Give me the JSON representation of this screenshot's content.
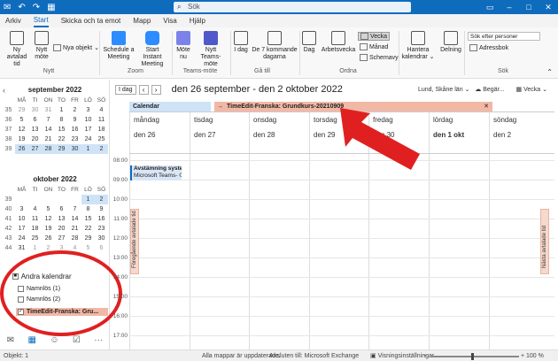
{
  "titlebar": {
    "search_placeholder": "Sök",
    "icons": [
      "envelope-icon",
      "undo-icon",
      "redo-icon",
      "calendar-icon"
    ],
    "accent": "#0f6cbd"
  },
  "menu": [
    "Arkiv",
    "Start",
    "Skicka och ta emot",
    "Mapp",
    "Visa",
    "Hjälp"
  ],
  "ribbon": {
    "new_appt": "Ny avtalad tid",
    "new_meeting": "Nytt möte",
    "new_items": "Nya objekt",
    "group_new": "Nytt",
    "schedule": "Schedule a Meeting",
    "start_instant": "Start Instant Meeting",
    "group_zoom": "Zoom",
    "meet_now": "Möte nu",
    "new_teams": "Nytt Teams-möte",
    "group_teams": "Teams-möte",
    "today": "I dag",
    "next7": "De 7 kommande dagarna",
    "group_goto": "Gå till",
    "day": "Dag",
    "workweek": "Arbetsvecka",
    "week": "Vecka",
    "month": "Månad",
    "schedule_view": "Schemavy",
    "group_arrange": "Ordna",
    "manage": "Hantera kalendrar",
    "share": "Delning",
    "search_people": "Sök efter personer",
    "addressbook": "Adressbok",
    "group_search": "Sök"
  },
  "calendar_header": {
    "today_btn": "I dag",
    "range": "den 26 september - den 2 oktober 2022",
    "tz": "Lund, Skåne län",
    "weather": "Begär...",
    "view": "Vecka"
  },
  "tabs": {
    "calendar": "Calendar",
    "timeedit": "TimeEdit-Franska: Grundkurs-20210909"
  },
  "days": [
    {
      "name": "måndag",
      "num": "den 26"
    },
    {
      "name": "tisdag",
      "num": "den 27"
    },
    {
      "name": "onsdag",
      "num": "den 28"
    },
    {
      "name": "torsdag",
      "num": "den 29"
    },
    {
      "name": "fredag",
      "num": "den 30"
    },
    {
      "name": "lördag",
      "num": "den 1 okt"
    },
    {
      "name": "söndag",
      "num": "den 2"
    }
  ],
  "times": [
    "08:00",
    "09:00",
    "10:00",
    "11:00",
    "12:00",
    "13:00",
    "14:00",
    "15:00",
    "16:00",
    "17:00"
  ],
  "event": {
    "title": "Avstämning system",
    "sub": "Microsoft Teams-"
  },
  "side_tabs": {
    "prev": "Föregående avtalade tid",
    "next": "Nästa avtalade tid"
  },
  "mini_sep": {
    "title": "september 2022",
    "headers": [
      "MÅ",
      "TI",
      "ON",
      "TO",
      "FR",
      "LÖ",
      "SÖ"
    ],
    "weeks": [
      [
        "35",
        "29",
        "30",
        "31",
        "1",
        "2",
        "3",
        "4"
      ],
      [
        "36",
        "5",
        "6",
        "7",
        "8",
        "9",
        "10",
        "11"
      ],
      [
        "37",
        "12",
        "13",
        "14",
        "15",
        "16",
        "17",
        "18"
      ],
      [
        "38",
        "19",
        "20",
        "21",
        "22",
        "23",
        "24",
        "25"
      ],
      [
        "39",
        "26",
        "27",
        "28",
        "29",
        "30",
        "1",
        "2"
      ]
    ]
  },
  "mini_oct": {
    "title": "oktober 2022",
    "headers": [
      "MÅ",
      "TI",
      "ON",
      "TO",
      "FR",
      "LÖ",
      "SÖ"
    ],
    "weeks": [
      [
        "39",
        "",
        "",
        "",
        "",
        "",
        "1",
        "2"
      ],
      [
        "40",
        "3",
        "4",
        "5",
        "6",
        "7",
        "8",
        "9"
      ],
      [
        "41",
        "10",
        "11",
        "12",
        "13",
        "14",
        "15",
        "16"
      ],
      [
        "42",
        "17",
        "18",
        "19",
        "20",
        "21",
        "22",
        "23"
      ],
      [
        "43",
        "24",
        "25",
        "26",
        "27",
        "28",
        "29",
        "30"
      ],
      [
        "44",
        "31",
        "1",
        "2",
        "3",
        "4",
        "5",
        "6"
      ]
    ]
  },
  "other_calendars": {
    "title": "Andra kalendrar",
    "items": [
      "Namnlös (1)",
      "Namnlös (2)",
      "TimeEdit-Franska: Gru..."
    ]
  },
  "status": {
    "items": "Objekt: 1",
    "updated": "Alla mappar är uppdaterade.",
    "connected": "Ansluten till: Microsoft Exchange",
    "view_settings": "Visningsinställningar",
    "zoom_pct": "100 %",
    "zoom_level": 1.0
  },
  "annotation_colors": {
    "red": "#e02020",
    "highlight": "#f2b8a6"
  }
}
